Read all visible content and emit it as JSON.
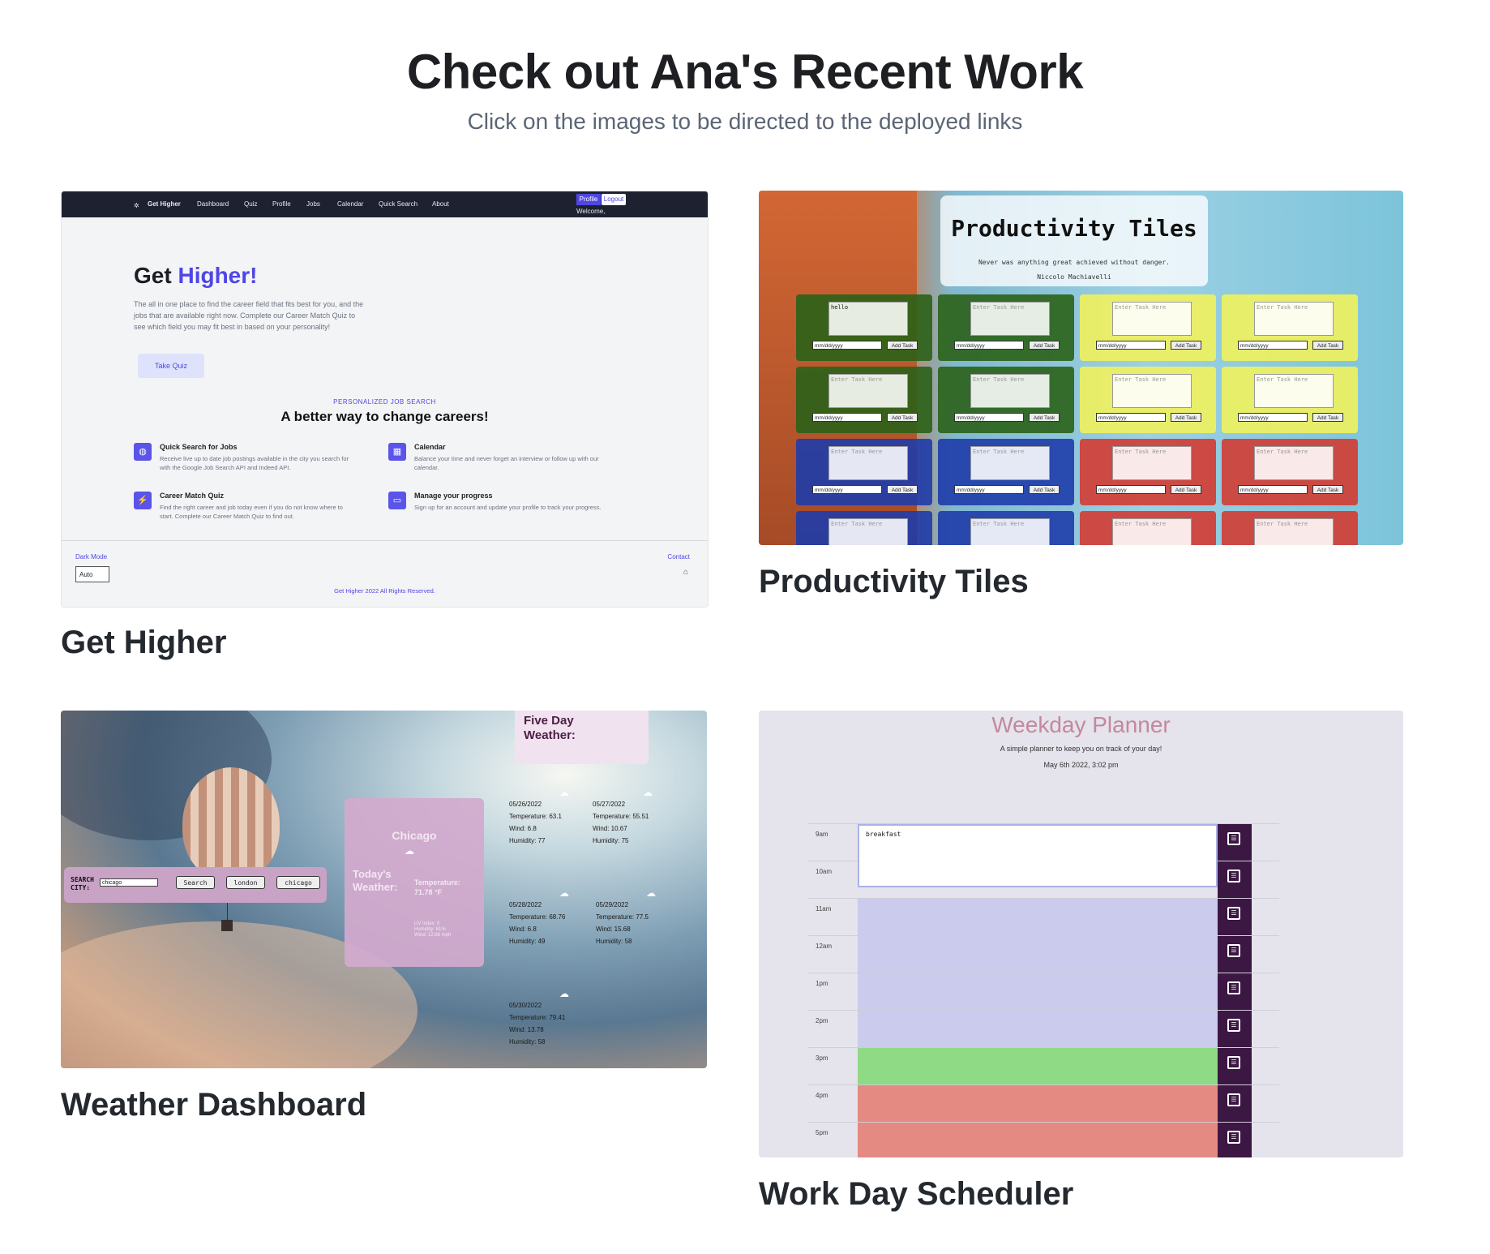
{
  "header": {
    "title": "Check out Ana's Recent Work",
    "subtitle": "Click on the images to be directed to the deployed links"
  },
  "projects": [
    {
      "title": "Get Higher",
      "screenshot": {
        "brand": "Get Higher",
        "nav": [
          "Dashboard",
          "Quiz",
          "Profile",
          "Jobs",
          "Calendar",
          "Quick Search",
          "About"
        ],
        "profile_btn": "Profile",
        "logout_btn": "Logout",
        "welcome": "Welcome,",
        "hero_plain": "Get",
        "hero_accent": "Higher!",
        "hero_text": "The all in one place to find the career field that fits best for you, and the jobs that are available right now. Complete our Career Match Quiz to see which field you may fit best in based on your personality!",
        "cta": "Take Quiz",
        "eyebrow": "PERSONALIZED JOB SEARCH",
        "heading": "A better way to change careers!",
        "features": [
          {
            "title": "Quick Search for Jobs",
            "text": "Receive live up to date job postings available in the city you search for with the Google Job Search API and Indeed API."
          },
          {
            "title": "Calendar",
            "text": "Balance your time and never forget an interview or follow up with our calendar."
          },
          {
            "title": "Career Match Quiz",
            "text": "Find the right career and job today even if you do not know where to start. Complete our Career Match Quiz to find out."
          },
          {
            "title": "Manage your progress",
            "text": "Sign up for an account and update your profile to track your progress."
          }
        ],
        "dark_mode_label": "Dark Mode",
        "dark_mode_value": "Auto",
        "contact": "Contact",
        "copyright": "Get Higher 2022 All Rights Reserved."
      }
    },
    {
      "title": "Productivity Tiles",
      "screenshot": {
        "title": "Productivity Tiles",
        "quote": "Never was anything great achieved without danger.",
        "author": "Niccolo Machiavelli",
        "first_task": "hello",
        "placeholder": "Enter Task Here",
        "date_placeholder": "mm/dd/yyyy",
        "add_button": "Add Task"
      }
    },
    {
      "title": "Weather Dashboard",
      "screenshot": {
        "search_label": "SEARCH CITY:",
        "search_value": "chicago",
        "buttons": [
          "Search",
          "london",
          "chicago"
        ],
        "city": "Chicago",
        "today_label": "Today's Weather:",
        "today_temp": "Temperature: 71.78 °F",
        "today_small": [
          "UV Index: 0",
          "Humidity: 61%",
          "Wind: 12.66 mph"
        ],
        "five_day_title": "Five Day Weather:",
        "days": [
          {
            "date": "05/26/2022",
            "temp": "Temperature: 63.1",
            "wind": "Wind: 6.8",
            "humidity": "Humidity: 77"
          },
          {
            "date": "05/27/2022",
            "temp": "Temperature: 55.51",
            "wind": "Wind: 10.67",
            "humidity": "Humidity: 75"
          },
          {
            "date": "05/28/2022",
            "temp": "Temperature: 68.76",
            "wind": "Wind: 6.8",
            "humidity": "Humidity: 49"
          },
          {
            "date": "05/29/2022",
            "temp": "Temperature: 77.5",
            "wind": "Wind: 15.68",
            "humidity": "Humidity: 58"
          },
          {
            "date": "05/30/2022",
            "temp": "Temperature: 79.41",
            "wind": "Wind: 13.78",
            "humidity": "Humidity: 58"
          }
        ]
      }
    },
    {
      "title": "Work Day Scheduler",
      "screenshot": {
        "title": "Weekday Planner",
        "subtitle": "A simple planner to keep you on track of your day!",
        "date": "May 6th 2022, 3:02 pm",
        "hours": [
          "9am",
          "10am",
          "11am",
          "12am",
          "1pm",
          "2pm",
          "3pm",
          "4pm",
          "5pm"
        ],
        "first_entry": "breakfast",
        "colors": {
          "past": "#cbcbee",
          "present": "#8fda84",
          "future": "#e48a82",
          "save": "#3c1743"
        }
      }
    }
  ]
}
